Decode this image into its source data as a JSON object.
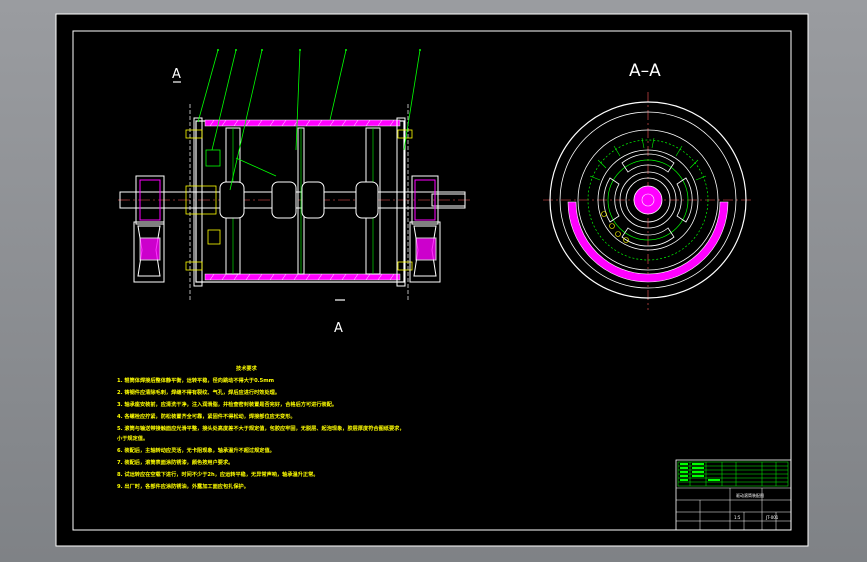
{
  "drawing": {
    "section_label_left_top": "A",
    "section_label_left_bottom": "A",
    "section_view_title": "A–A"
  },
  "tech_requirements": {
    "heading": "技术要求",
    "lines": [
      "1. 辊筒体焊接后整体静平衡，运转平稳，径向跳动不得大于0.5mm",
      "2. 铸钢件应清除毛刺，焊缝不得有裂纹、气孔，焊后应进行时效处理。",
      "3. 轴承座安装前，应清洗干净，注入润滑脂，并检查密封装置是否完好，合格后方可进行装配。",
      "4. 各螺栓应拧紧，防松装置齐全可靠，紧固件不得松动，焊接部位应无变形。",
      "5. 滚筒与输送带接触面应光滑平整，接头处高度差不大于规定值，包胶应牢固，无脱层、起泡现象，胶层厚度符合图纸要求，",
      "   小于规定值。",
      "6. 装配后，主轴转动应灵活，无卡阻现象，轴承温升不超过规定值。",
      "7. 装配后，滚筒表面涂防锈漆，颜色按用户要求。",
      "8. 试运转应在空载下进行，时间不少于2h，应运转平稳，无异常声响，轴承温升正常。",
      "9. 出厂时，各部件应涂防锈油，外露加工面应包扎保护。"
    ]
  },
  "title_block": {
    "drawing_name": "驱动滚筒装配图",
    "scale": "1:5",
    "sheet_code": "JT-001"
  },
  "colors": {
    "background": "#000000",
    "outline": "#ffffff",
    "leader": "#00ff00",
    "rubber": "#ff00ff",
    "notes": "#ffff00"
  }
}
